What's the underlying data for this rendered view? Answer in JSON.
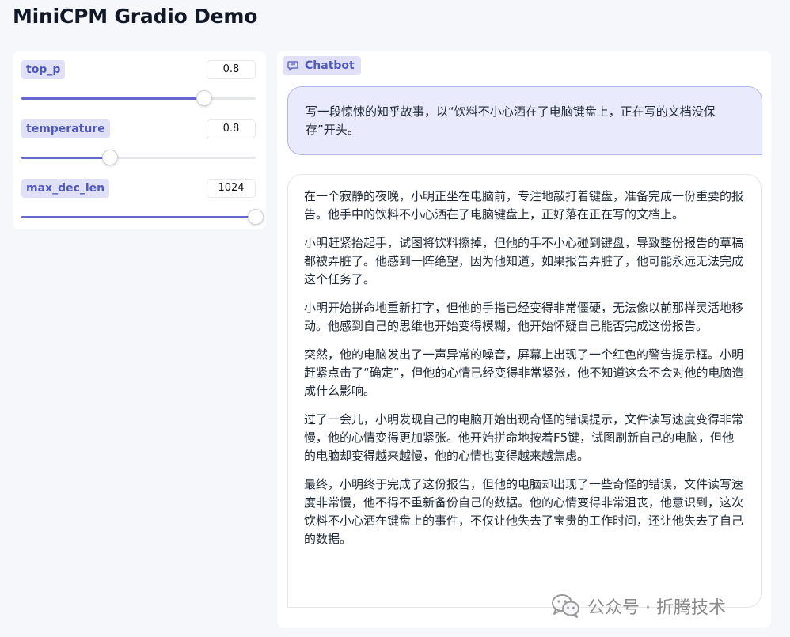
{
  "app": {
    "title": "MiniCPM Gradio Demo"
  },
  "controls": [
    {
      "label": "top_p",
      "value": "0.8",
      "fraction": 0.78
    },
    {
      "label": "temperature",
      "value": "0.8",
      "fraction": 0.38
    },
    {
      "label": "max_dec_len",
      "value": "1024",
      "fraction": 1.0
    }
  ],
  "chatbot": {
    "label": "Chatbot",
    "user_message": "写一段惊悚的知乎故事，以“饮料不小心洒在了电脑键盘上，正在写的文档没保存”开头。",
    "bot_paragraphs": [
      "在一个寂静的夜晚，小明正坐在电脑前，专注地敲打着键盘，准备完成一份重要的报告。他手中的饮料不小心洒在了电脑键盘上，正好落在正在写的文档上。",
      "小明赶紧抬起手，试图将饮料擦掉，但他的手不小心碰到键盘，导致整份报告的草稿都被弄脏了。他感到一阵绝望，因为他知道，如果报告弄脏了，他可能永远无法完成这个任务了。",
      "小明开始拼命地重新打字，但他的手指已经变得非常僵硬，无法像以前那样灵活地移动。他感到自己的思维也开始变得模糊，他开始怀疑自己能否完成这份报告。",
      "突然，他的电脑发出了一声异常的噪音，屏幕上出现了一个红色的警告提示框。小明赶紧点击了“确定”，但他的心情已经变得非常紧张，他不知道这会不会对他的电脑造成什么影响。",
      "过了一会儿，小明发现自己的电脑开始出现奇怪的错误提示，文件读写速度变得非常慢，他的心情变得更加紧张。他开始拼命地按着F5键，试图刷新自己的电脑，但他的电脑却变得越来越慢，他的心情也变得越来越焦虑。",
      "最终，小明终于完成了这份报告，但他的电脑却出现了一些奇怪的错误，文件读写速度非常慢，他不得不重新备份自己的数据。他的心情变得非常沮丧，他意识到，这次饮料不小心洒在键盘上的事件，不仅让他失去了宝贵的工作时间，还让他失去了自己的数据。"
    ]
  },
  "watermark": {
    "text": "公众号 · 折腾技术",
    "icon": "wechat-icon"
  },
  "colors": {
    "accent": "#6666d0",
    "label_bg": "#e0e1f7",
    "label_text": "#5058b8",
    "user_bubble": "#e9eafc"
  }
}
